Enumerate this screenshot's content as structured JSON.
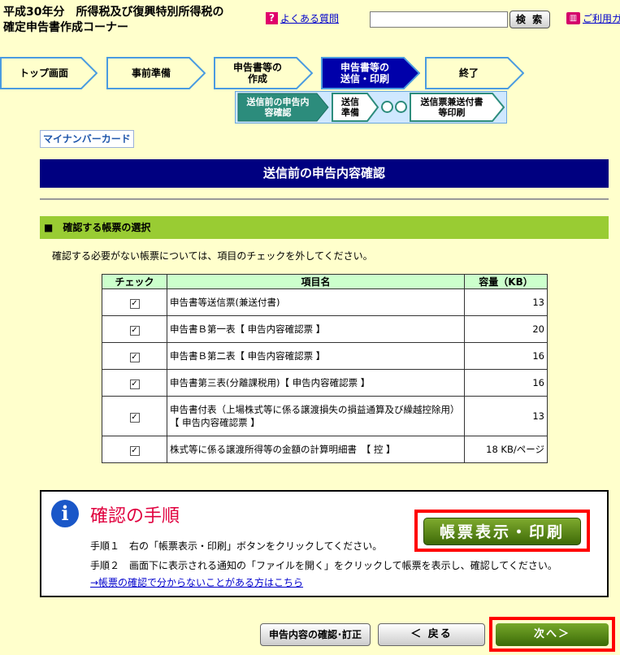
{
  "header": {
    "title_line1": "平成30年分　所得税及び復興特別所得税の",
    "title_line2": "確定申告書作成コーナー",
    "faq_icon": "?",
    "faq_link": "よくある質問",
    "search_value": "",
    "search_button": "検 索",
    "guide_icon": "book-icon",
    "guide_link": "ご利用ガ"
  },
  "steps": [
    {
      "label": "トップ画面",
      "active": false
    },
    {
      "label": "事前準備",
      "active": false
    },
    {
      "label": "申告書等の\n作成",
      "active": false
    },
    {
      "label": "申告書等の\n送信・印刷",
      "active": true
    },
    {
      "label": "終了",
      "active": false
    }
  ],
  "substeps": [
    {
      "label": "送信前の申告内\n容確認",
      "active": true
    },
    {
      "label": "送信\n準備",
      "active": false
    },
    {
      "label": "送信票兼送付書\n等印刷",
      "active": false
    }
  ],
  "card_label": "マイナンバーカード",
  "page_title": "送信前の申告内容確認",
  "section_title": "■　確認する帳票の選択",
  "instruction": "確認する必要がない帳票については、項目のチェックを外してください。",
  "table": {
    "headers": [
      "チェック",
      "項目名",
      "容量（KB）"
    ],
    "rows": [
      {
        "checked": true,
        "name": "申告書等送信票(兼送付書)",
        "size": "13"
      },
      {
        "checked": true,
        "name": "申告書Ｂ第一表【 申告内容確認票 】",
        "size": "20"
      },
      {
        "checked": true,
        "name": "申告書Ｂ第二表【 申告内容確認票 】",
        "size": "16"
      },
      {
        "checked": true,
        "name": "申告書第三表(分離課税用)【 申告内容確認票 】",
        "size": "16"
      },
      {
        "checked": true,
        "name": "申告書付表（上場株式等に係る譲渡損失の損益通算及び繰越控除用）　【 申告内容確認票 】",
        "size": "13"
      },
      {
        "checked": true,
        "name": "株式等に係る譲渡所得等の金額の計算明細書　【 控 】",
        "size": "18 KB/ページ"
      }
    ]
  },
  "procedure": {
    "icon": "i",
    "title": "確認の手順",
    "step1": "手順１　右の「帳票表示・印刷」ボタンをクリックしてください。",
    "step2": "手順２　画面下に表示される通知の「ファイルを開く」をクリックして帳票を表示し、確認してください。",
    "help_link": "→帳票の確認で分からないことがある方はこちら",
    "print_button": "帳票表示・印刷"
  },
  "footer": {
    "review_button": "申告内容の確認･訂正",
    "back_button": "＜ 戻る",
    "next_button": "次へ＞"
  },
  "colors": {
    "page_bg": "#ffffcc",
    "banner": "#000080",
    "section": "#99cc33",
    "step_active": "#0000aa",
    "substep": "#2c8c7c",
    "highlight": "#ff0000",
    "green_button": "#5a8a18"
  }
}
